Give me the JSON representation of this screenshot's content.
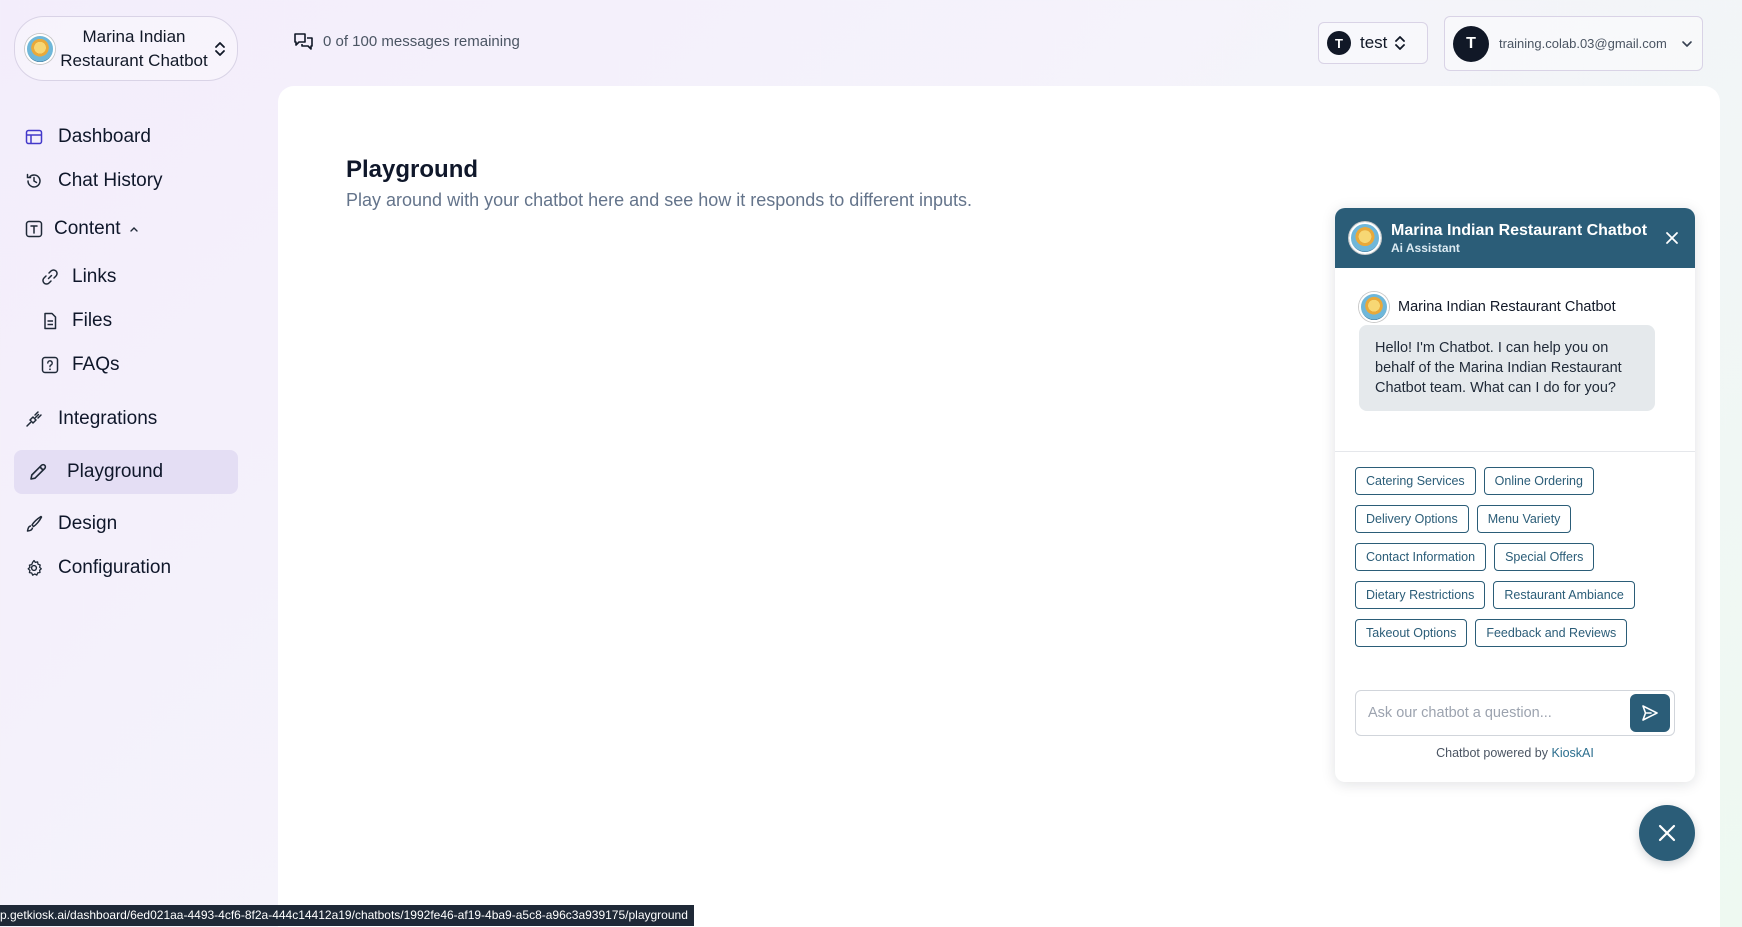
{
  "header": {
    "bot_name": "Marina Indian Restaurant Chatbot",
    "message_quota": "0 of 100 messages remaining",
    "workspace_initial": "T",
    "workspace_name": "test",
    "account_initial": "T",
    "account_email": "training.colab.03@gmail.com"
  },
  "sidebar": {
    "dashboard": "Dashboard",
    "chat_history": "Chat History",
    "content": "Content",
    "links": "Links",
    "files": "Files",
    "faqs": "FAQs",
    "integrations": "Integrations",
    "playground": "Playground",
    "design": "Design",
    "configuration": "Configuration"
  },
  "main": {
    "title": "Playground",
    "subtitle": "Play around with your chatbot here and see how it responds to different inputs."
  },
  "chat": {
    "title": "Marina Indian Restaurant Chatbot",
    "subtitle": "Ai Assistant",
    "bot_label": "Marina Indian Restaurant Chatbot",
    "greeting": "Hello! I'm Chatbot. I can help you on behalf of the Marina Indian Restaurant Chatbot team. What can I do for you?",
    "suggestions": [
      "Catering Services",
      "Online Ordering",
      "Delivery Options",
      "Menu Variety",
      "Contact Information",
      "Special Offers",
      "Dietary Restrictions",
      "Restaurant Ambiance",
      "Takeout Options",
      "Feedback and Reviews"
    ],
    "input_placeholder": "Ask our chatbot a question...",
    "input_value": "",
    "powered_prefix": "Chatbot powered by ",
    "powered_brand": "KioskAI",
    "accent_color": "#2b5d78"
  },
  "status_bar": {
    "url": "p.getkiosk.ai/dashboard/6ed021aa-4493-4cf6-8f2a-444c14412a19/chatbots/1992fe46-af19-4ba9-a5c8-a96c3a939175/playground"
  }
}
